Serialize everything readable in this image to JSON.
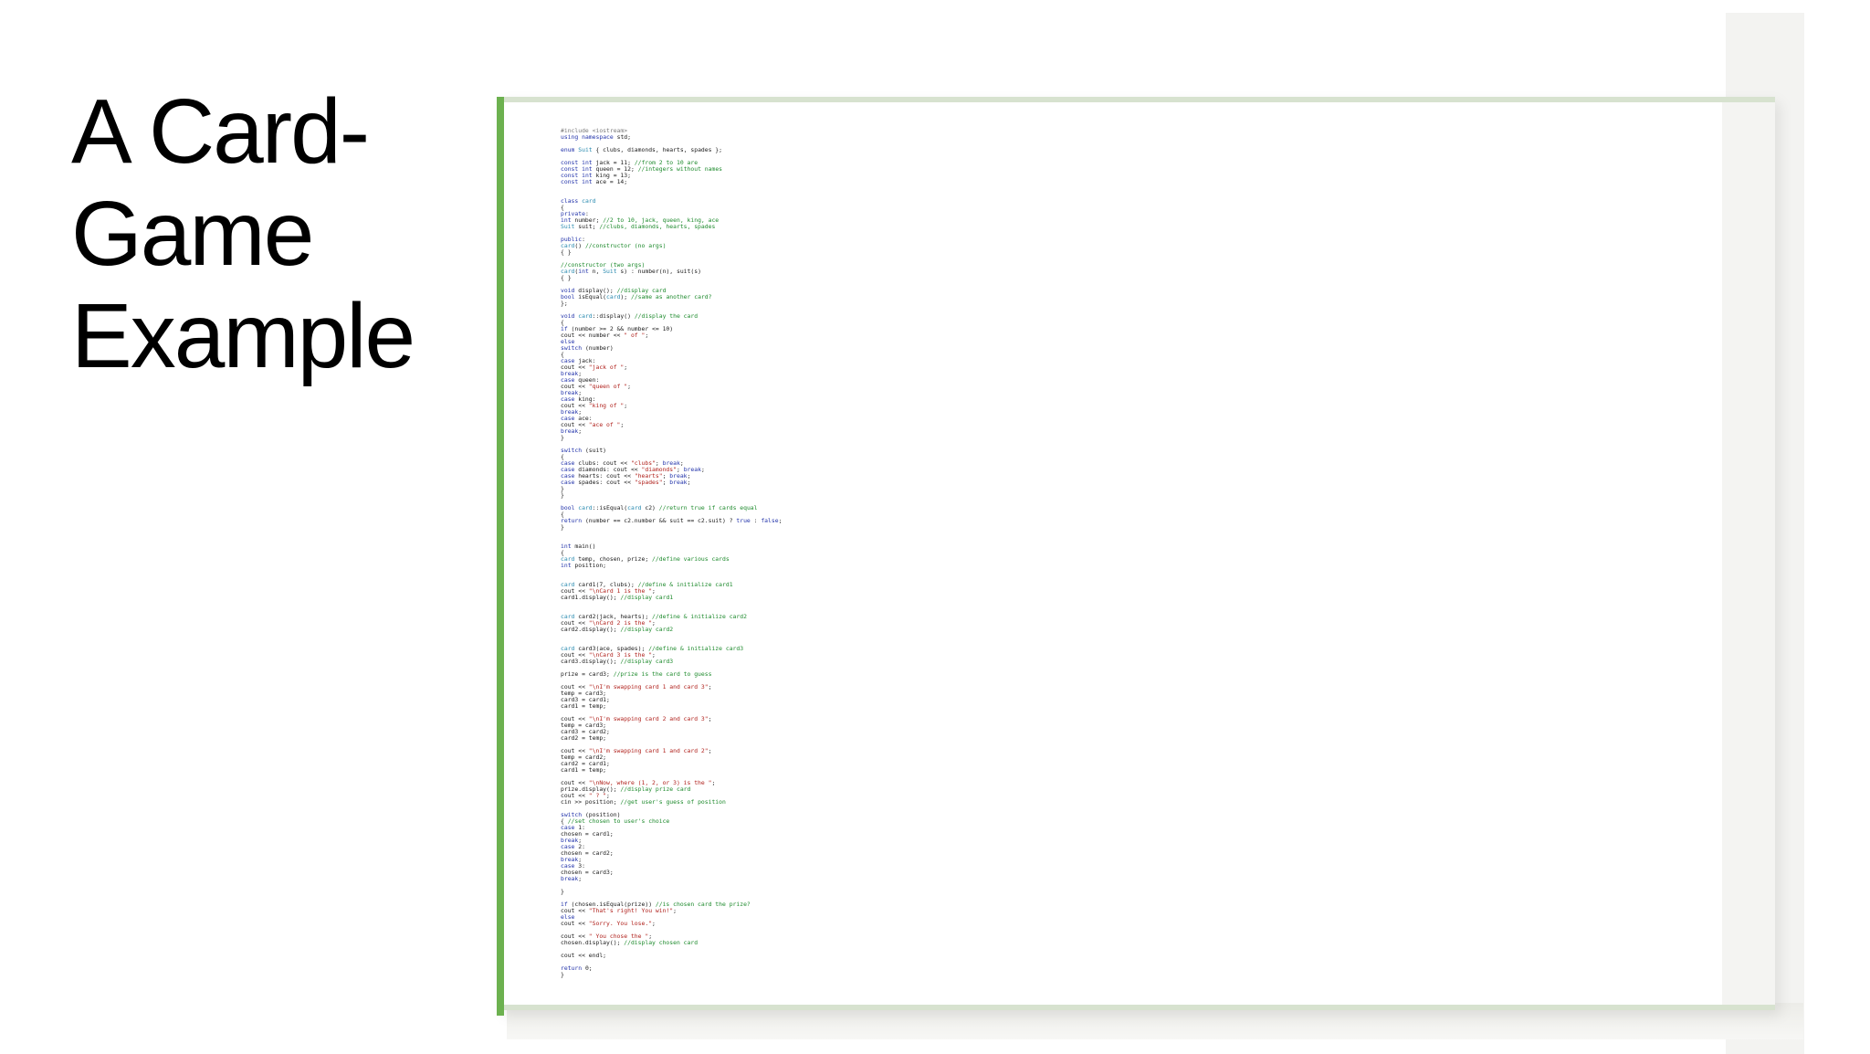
{
  "slide": {
    "title_lines": [
      "A Card-",
      "Game",
      "Example"
    ]
  },
  "code_lines": [
    "#include <iostream>",
    "using namespace std;",
    "",
    "enum Suit { clubs, diamonds, hearts, spades };",
    "",
    "const int jack = 11; //from 2 to 10 are",
    "const int queen = 12; //integers without names",
    "const int king = 13;",
    "const int ace = 14;",
    "",
    "",
    "class card",
    "{",
    "private:",
    "int number; //2 to 10, jack, queen, king, ace",
    "Suit suit; //clubs, diamonds, hearts, spades",
    "",
    "public:",
    "card() //constructor (no args)",
    "{ }",
    "",
    "//constructor (two args)",
    "card(int n, Suit s) : number(n), suit(s)",
    "{ }",
    "",
    "void display(); //display card",
    "bool isEqual(card); //same as another card?",
    "};",
    "",
    "void card::display() //display the card",
    "{",
    "if (number >= 2 && number <= 10)",
    "cout << number << \" of \";",
    "else",
    "switch (number)",
    "{",
    "case jack:",
    "cout << \"jack of \";",
    "break;",
    "case queen:",
    "cout << \"queen of \";",
    "break;",
    "case king:",
    "cout << \"king of \";",
    "break;",
    "case ace:",
    "cout << \"ace of \";",
    "break;",
    "}",
    "",
    "switch (suit)",
    "{",
    "case clubs: cout << \"clubs\"; break;",
    "case diamonds: cout << \"diamonds\"; break;",
    "case hearts: cout << \"hearts\"; break;",
    "case spades: cout << \"spades\"; break;",
    "}",
    "}",
    "",
    "bool card::isEqual(card c2) //return true if cards equal",
    "{",
    "return (number == c2.number && suit == c2.suit) ? true : false;",
    "}",
    "",
    "",
    "int main()",
    "{",
    "card temp, chosen, prize; //define various cards",
    "int position;",
    "",
    "",
    "card card1(7, clubs); //define & initialize card1",
    "cout << \"\\nCard 1 is the \";",
    "card1.display(); //display card1",
    "",
    "",
    "card card2(jack, hearts); //define & initialize card2",
    "cout << \"\\nCard 2 is the \";",
    "card2.display(); //display card2",
    "",
    "",
    "card card3(ace, spades); //define & initialize card3",
    "cout << \"\\nCard 3 is the \";",
    "card3.display(); //display card3",
    "",
    "prize = card3; //prize is the card to guess",
    "",
    "cout << \"\\nI'm swapping card 1 and card 3\";",
    "temp = card3;",
    "card3 = card1;",
    "card1 = temp;",
    "",
    "cout << \"\\nI'm swapping card 2 and card 3\";",
    "temp = card3;",
    "card3 = card2;",
    "card2 = temp;",
    "",
    "cout << \"\\nI'm swapping card 1 and card 2\";",
    "temp = card2;",
    "card2 = card1;",
    "card1 = temp;",
    "",
    "cout << \"\\nNow, where (1, 2, or 3) is the \";",
    "prize.display(); //display prize card",
    "cout << \" ? \";",
    "cin >> position; //get user's guess of position",
    "",
    "switch (position)",
    "{ //set chosen to user's choice",
    "case 1:",
    "chosen = card1;",
    "break;",
    "case 2:",
    "chosen = card2;",
    "break;",
    "case 3:",
    "chosen = card3;",
    "break;",
    "",
    "}",
    "",
    "if (chosen.isEqual(prize)) //is chosen card the prize?",
    "cout << \"That's right! You win!\";",
    "else",
    "cout << \"Sorry. You lose.\";",
    "",
    "cout << \" You chose the \";",
    "chosen.display(); //display chosen card",
    "",
    "cout << endl;",
    "",
    "return 0;",
    "}"
  ],
  "colors": {
    "keyword": "#2233aa",
    "comment": "#1d8a2c",
    "string": "#b0211c",
    "type": "#2a8bb0",
    "accent": "#6cb14f"
  }
}
